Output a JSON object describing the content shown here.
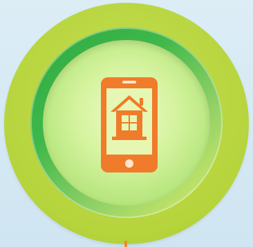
{
  "graphic": {
    "icon": "phone-home-icon",
    "colors": {
      "background": "#d6eaf4",
      "outer_ring": "#b6d43c",
      "bevel_ring_dark": "#2eaa43",
      "bevel_ring_light": "#dfef6a",
      "inner_disk": "#d5f39e",
      "icon": "#f07b2b",
      "stem": "#f08a2c"
    }
  }
}
